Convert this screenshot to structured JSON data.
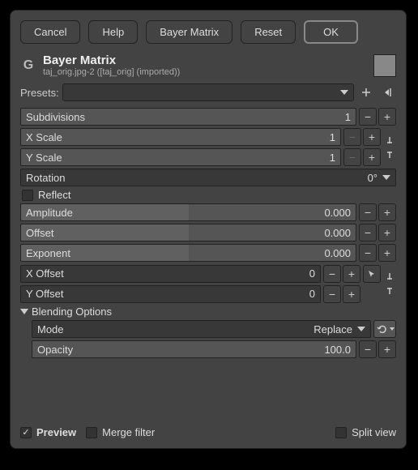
{
  "buttons": {
    "cancel": "Cancel",
    "help": "Help",
    "name": "Bayer Matrix",
    "reset": "Reset",
    "ok": "OK"
  },
  "header": {
    "title": "Bayer Matrix",
    "sub": "taj_orig.jpg-2 ([taj_orig] (imported))"
  },
  "presets": {
    "label": "Presets:"
  },
  "params": {
    "subdivisions": {
      "label": "Subdivisions",
      "val": "1"
    },
    "xscale": {
      "label": "X Scale",
      "val": "1"
    },
    "yscale": {
      "label": "Y Scale",
      "val": "1"
    },
    "rotation": {
      "label": "Rotation",
      "val": "0°"
    },
    "reflect": {
      "label": "Reflect"
    },
    "amplitude": {
      "label": "Amplitude",
      "val": "0.000"
    },
    "offset": {
      "label": "Offset",
      "val": "0.000"
    },
    "exponent": {
      "label": "Exponent",
      "val": "0.000"
    },
    "xoffset": {
      "label": "X Offset",
      "val": "0"
    },
    "yoffset": {
      "label": "Y Offset",
      "val": "0"
    }
  },
  "blending": {
    "title": "Blending Options",
    "mode_label": "Mode",
    "mode_val": "Replace",
    "opacity_label": "Opacity",
    "opacity_val": "100.0"
  },
  "footer": {
    "preview": "Preview",
    "merge": "Merge filter",
    "split": "Split view"
  }
}
